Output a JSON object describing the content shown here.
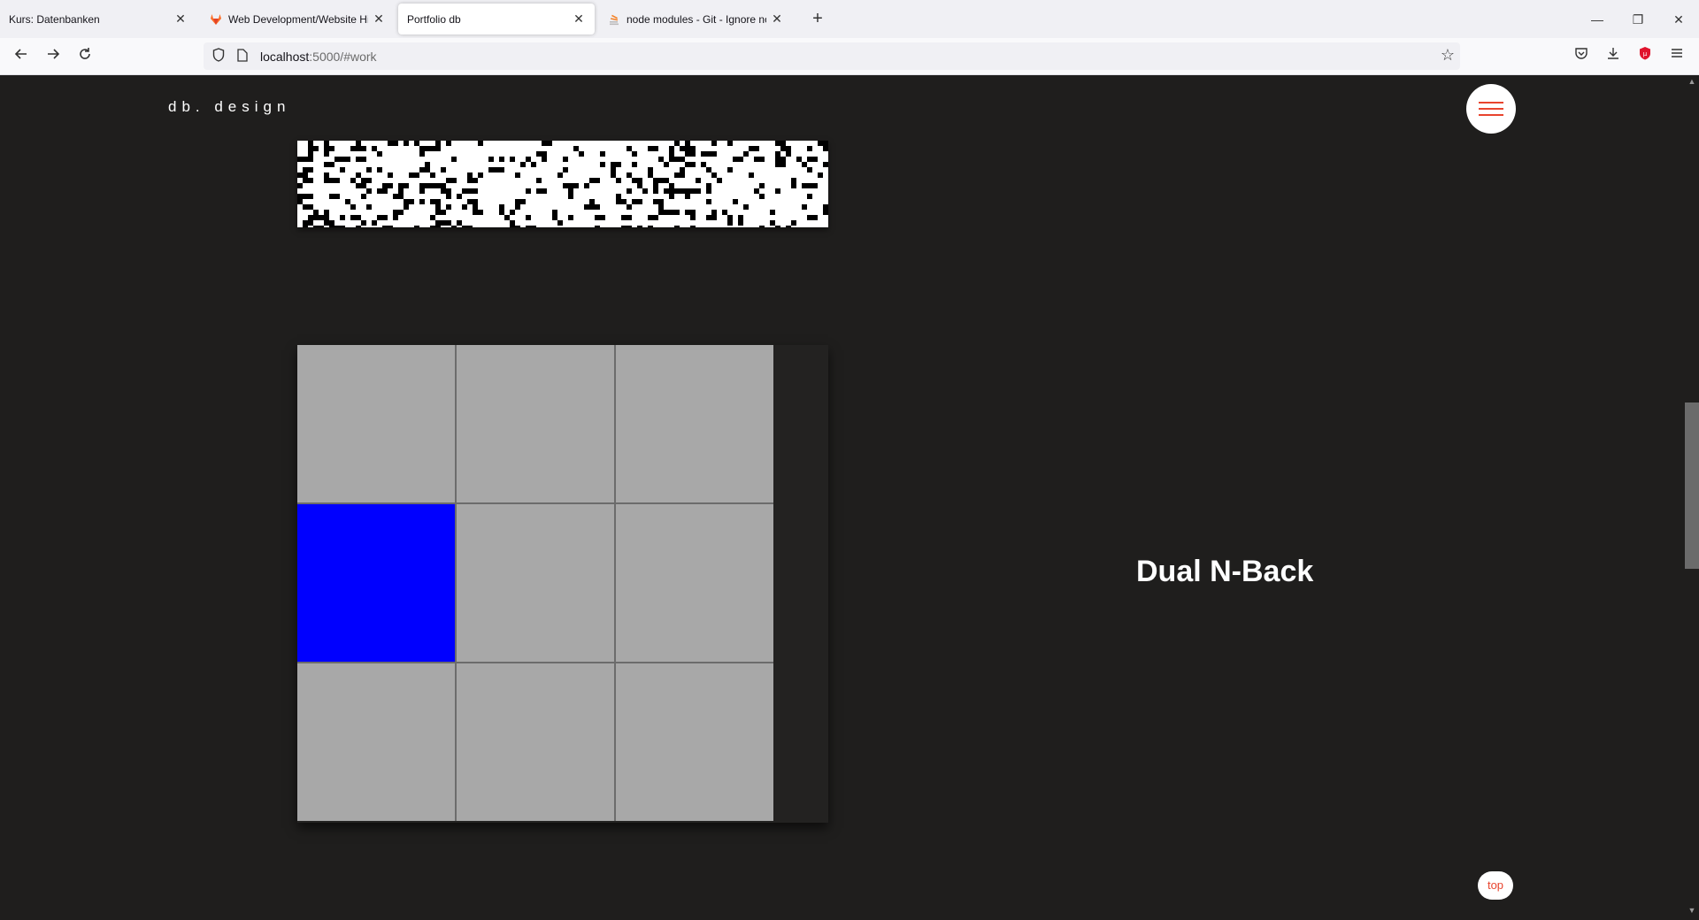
{
  "tabs": [
    {
      "label": "Kurs: Datenbanken",
      "favicon": "none"
    },
    {
      "label": "Web Development/Website Hin",
      "favicon": "gitlab-icon"
    },
    {
      "label": "Portfolio db",
      "favicon": "none",
      "active": true
    },
    {
      "label": "node modules - Git - Ignore no",
      "favicon": "stackoverflow-icon"
    }
  ],
  "newtab_label": "+",
  "window_controls": {
    "minimize": "—",
    "restore": "❐",
    "close": "✕"
  },
  "nav": {
    "url_host": "localhost",
    "url_rest": ":5000/#work"
  },
  "site": {
    "brand": "db. design",
    "project_title": "Dual N-Back",
    "top_label": "top"
  },
  "nback_grid": {
    "rows": 3,
    "cols": 3,
    "active_cell": [
      1,
      0
    ],
    "cell_color": "#a8a8a8",
    "active_color": "#0000ff"
  },
  "colors": {
    "accent": "#e8442e",
    "page_bg": "#1f1e1d"
  }
}
